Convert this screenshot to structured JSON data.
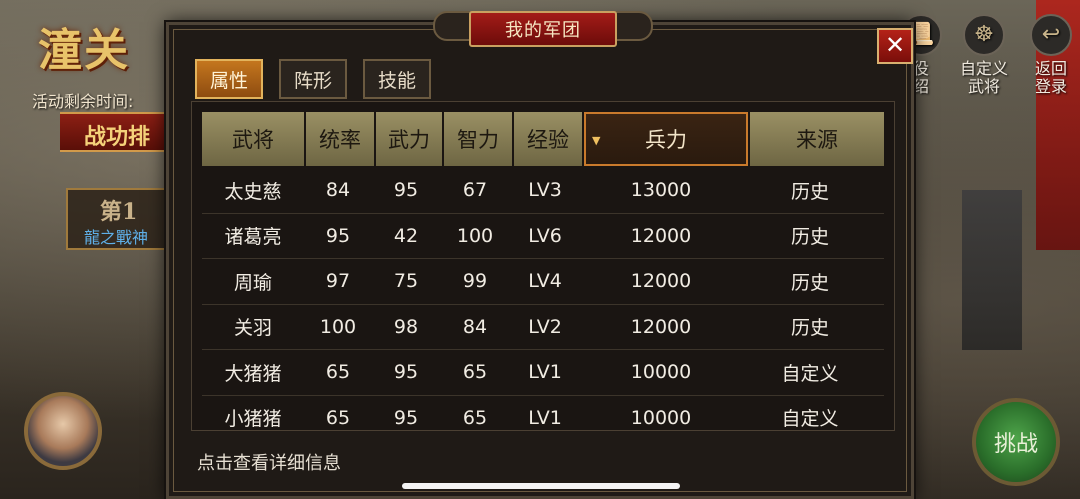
{
  "background": {
    "title": "潼关",
    "timer_label": "活动剩余时间:",
    "ribbon": "战功排",
    "rank_number": "第1",
    "rank_name": "龍之戰神",
    "top_icons": [
      {
        "icon": "book-icon",
        "label_1": "役",
        "label_2": "绍"
      },
      {
        "icon": "custom-general-icon",
        "label_1": "自定义",
        "label_2": "武将"
      },
      {
        "icon": "return-arrow-icon",
        "label_1": "返回",
        "label_2": "登录"
      }
    ],
    "challenge_label": "挑战"
  },
  "dialog": {
    "title": "我的军团",
    "close_glyph": "✕",
    "tabs": [
      {
        "label": "属性",
        "active": true
      },
      {
        "label": "阵形",
        "active": false
      },
      {
        "label": "技能",
        "active": false
      }
    ],
    "table": {
      "headers": [
        "武将",
        "统率",
        "武力",
        "智力",
        "经验",
        "兵力",
        "来源"
      ],
      "sorted_column": 5,
      "rows": [
        [
          "太史慈",
          "84",
          "95",
          "67",
          "LV3",
          "13000",
          "历史"
        ],
        [
          "诸葛亮",
          "95",
          "42",
          "100",
          "LV6",
          "12000",
          "历史"
        ],
        [
          "周瑜",
          "97",
          "75",
          "99",
          "LV4",
          "12000",
          "历史"
        ],
        [
          "关羽",
          "100",
          "98",
          "84",
          "LV2",
          "12000",
          "历史"
        ],
        [
          "大猪猪",
          "65",
          "95",
          "65",
          "LV1",
          "10000",
          "自定义"
        ],
        [
          "小猪猪",
          "65",
          "95",
          "65",
          "LV1",
          "10000",
          "自定义"
        ]
      ]
    },
    "hint": "点击查看详细信息"
  },
  "colors": {
    "accent_orange": "#c4761e",
    "close_red": "#b42218",
    "header_olive": "#9a9064",
    "panel_bg": "#1f1a16"
  }
}
